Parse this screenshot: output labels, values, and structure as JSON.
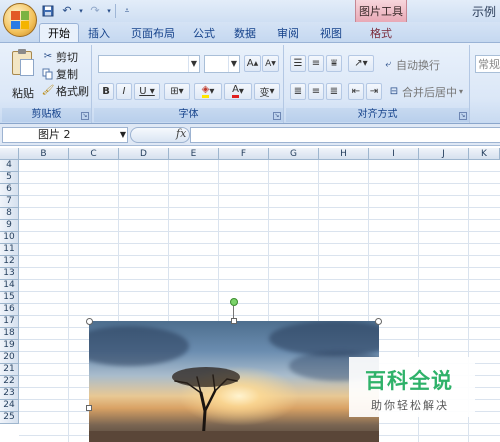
{
  "quick_access": {
    "icons": [
      "save-icon",
      "undo-icon",
      "redo-icon",
      "customize-icon"
    ]
  },
  "context_tab": {
    "label": "图片工具"
  },
  "app": {
    "title": "示例"
  },
  "tabs": [
    {
      "label": "开始",
      "active": true
    },
    {
      "label": "插入"
    },
    {
      "label": "页面布局"
    },
    {
      "label": "公式"
    },
    {
      "label": "数据"
    },
    {
      "label": "审阅"
    },
    {
      "label": "视图"
    },
    {
      "label": "格式"
    }
  ],
  "clipboard": {
    "paste": "粘贴",
    "cut": "剪切",
    "copy": "复制",
    "format_painter": "格式刷",
    "group_label": "剪贴板"
  },
  "font": {
    "font_name": "",
    "font_size": "",
    "bold": "B",
    "italic": "I",
    "underline": "U",
    "grow": "A",
    "shrink": "A",
    "font_color": "A",
    "phonetic": "变",
    "group_label": "字体"
  },
  "alignment": {
    "wrap_text": "自动换行",
    "merge_center": "合并后居中",
    "group_label": "对齐方式"
  },
  "number": {
    "format": "常规"
  },
  "formula_bar": {
    "name_box": "图片 2",
    "fx": "fx",
    "formula": ""
  },
  "columns": [
    "B",
    "C",
    "D",
    "E",
    "F",
    "G",
    "H",
    "I",
    "J",
    "K"
  ],
  "rows": [
    "4",
    "5",
    "6",
    "7",
    "8",
    "9",
    "10",
    "11",
    "12",
    "13",
    "14",
    "15",
    "16",
    "17",
    "18",
    "19",
    "20",
    "21",
    "22",
    "23",
    "24",
    "25"
  ],
  "watermark": {
    "title": "百科全说",
    "subtitle": "助你轻松解决"
  },
  "colors": {
    "ribbon": "#dbe7f7",
    "context_tab": "#e8a9b6",
    "watermark_green": "#2fb26a"
  }
}
